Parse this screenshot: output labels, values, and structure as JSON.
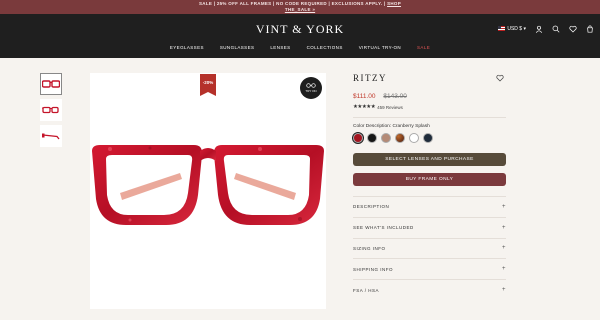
{
  "promo": {
    "text_1": "SALE | 25% OFF ALL FRAMES | NO CODE REQUIRED | EXCLUSIONS APPLY. |",
    "shop": "SHOP",
    "code": "THE_SALE »"
  },
  "header": {
    "logo": "VINT & YORK",
    "nav": [
      "EYEGLASSES",
      "SUNGLASSES",
      "LENSES",
      "COLLECTIONS",
      "VIRTUAL TRY-ON",
      "SALE"
    ],
    "currency": "USD $"
  },
  "gallery": {
    "discount_badge": "-20%",
    "try_on_label": "TRY ON"
  },
  "product": {
    "title": "RITZY",
    "sale_price": "$111.00",
    "original_price": "$143.00",
    "stars": "★★★★★",
    "reviews": "459 Reviews",
    "color_label": "Color Description: Cranberry Splash",
    "swatches": [
      "#a4141f",
      "#161616",
      "#b48a76",
      "#6a2c1c",
      "#ffffff",
      "#1f2b3a"
    ],
    "select_button": "SELECT LENSES AND PURCHASE",
    "buy_button": "BUY FRAME ONLY",
    "accordion": [
      "DESCRIPTION",
      "SEE WHAT'S INCLUDED",
      "SIZING INFO",
      "SHIPPING INFO",
      "FSA / HSA"
    ]
  },
  "colors": {
    "accent": "#7b3a3d",
    "frame": "#c4142a"
  }
}
